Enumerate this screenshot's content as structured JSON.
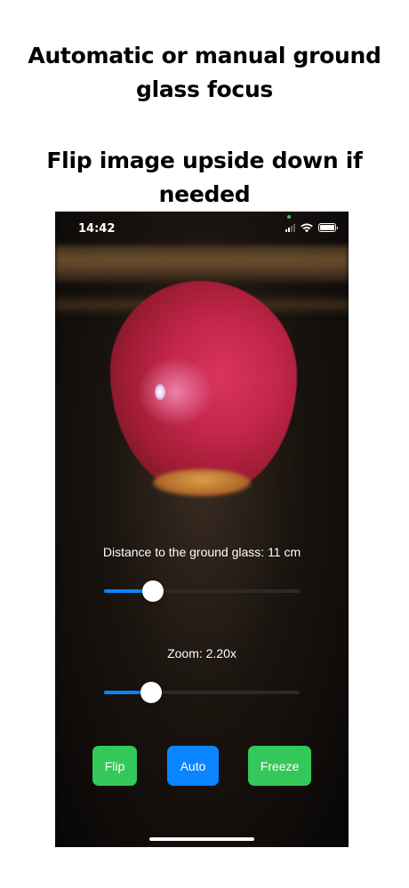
{
  "captions": {
    "line1": "Automatic or manual ground glass focus",
    "line2": "Flip image upside down if needed"
  },
  "status_bar": {
    "time": "14:42",
    "icons": [
      "signal-icon",
      "wifi-icon",
      "battery-icon"
    ]
  },
  "controls": {
    "distance_label": "Distance to the ground glass: 11 cm",
    "distance_fraction": 0.25,
    "zoom_label": "Zoom: 2.20x",
    "zoom_fraction": 0.24
  },
  "buttons": {
    "flip": "Flip",
    "auto": "Auto",
    "freeze": "Freeze"
  },
  "colors": {
    "flip_button": "#34c759",
    "auto_button": "#0a84ff",
    "freeze_button": "#34c759",
    "slider_accent": "#0a84ff"
  }
}
